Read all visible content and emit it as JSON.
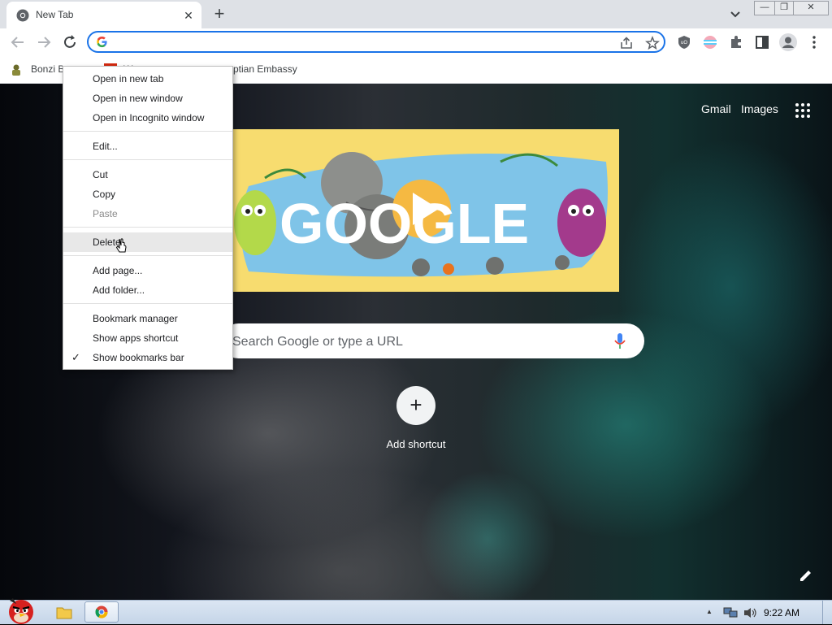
{
  "browser": {
    "tab": {
      "title": "New Tab",
      "close": "✕"
    },
    "new_tab": "+",
    "window_controls": {
      "minimize": "—",
      "restore": "❐",
      "close": "✕"
    },
    "omnibox": {
      "value": "",
      "placeholder": ""
    },
    "toolbar_icons": [
      "back-icon",
      "forward-icon",
      "reload-icon",
      "share-icon",
      "star-icon",
      "ublock-icon",
      "profile-extension-icon",
      "extensions-icon",
      "side-panel-icon",
      "profile-avatar-icon",
      "menu-icon"
    ]
  },
  "bookmarks": [
    {
      "label": "Bonzi B"
    },
    {
      "label": "W"
    },
    {
      "label": "ptian Embassy"
    }
  ],
  "ntp": {
    "gmail": "Gmail",
    "images": "Images",
    "doodle_word": "GOOGLE",
    "search_placeholder": "Search Google or type a URL",
    "add_shortcut_plus": "+",
    "add_shortcut_label": "Add shortcut"
  },
  "context_menu": {
    "items": [
      {
        "label": "Open in new tab",
        "state": "enabled"
      },
      {
        "label": "Open in new window",
        "state": "enabled"
      },
      {
        "label": "Open in Incognito window",
        "state": "enabled"
      },
      {
        "label": "Edit...",
        "state": "enabled"
      },
      {
        "label": "Cut",
        "state": "enabled"
      },
      {
        "label": "Copy",
        "state": "enabled"
      },
      {
        "label": "Paste",
        "state": "disabled"
      },
      {
        "label": "Delete",
        "state": "hover"
      },
      {
        "label": "Add page...",
        "state": "enabled"
      },
      {
        "label": "Add folder...",
        "state": "enabled"
      },
      {
        "label": "Bookmark manager",
        "state": "enabled"
      },
      {
        "label": "Show apps shortcut",
        "state": "enabled"
      },
      {
        "label": "Show bookmarks bar",
        "state": "checked"
      }
    ],
    "check_glyph": "✓"
  },
  "taskbar": {
    "clock": "9:22 AM",
    "tray_arrow": "▲"
  },
  "colors": {
    "accent": "#1a73e8",
    "tabstrip": "#dee1e6",
    "doodle_bg": "#f7dc6f"
  }
}
